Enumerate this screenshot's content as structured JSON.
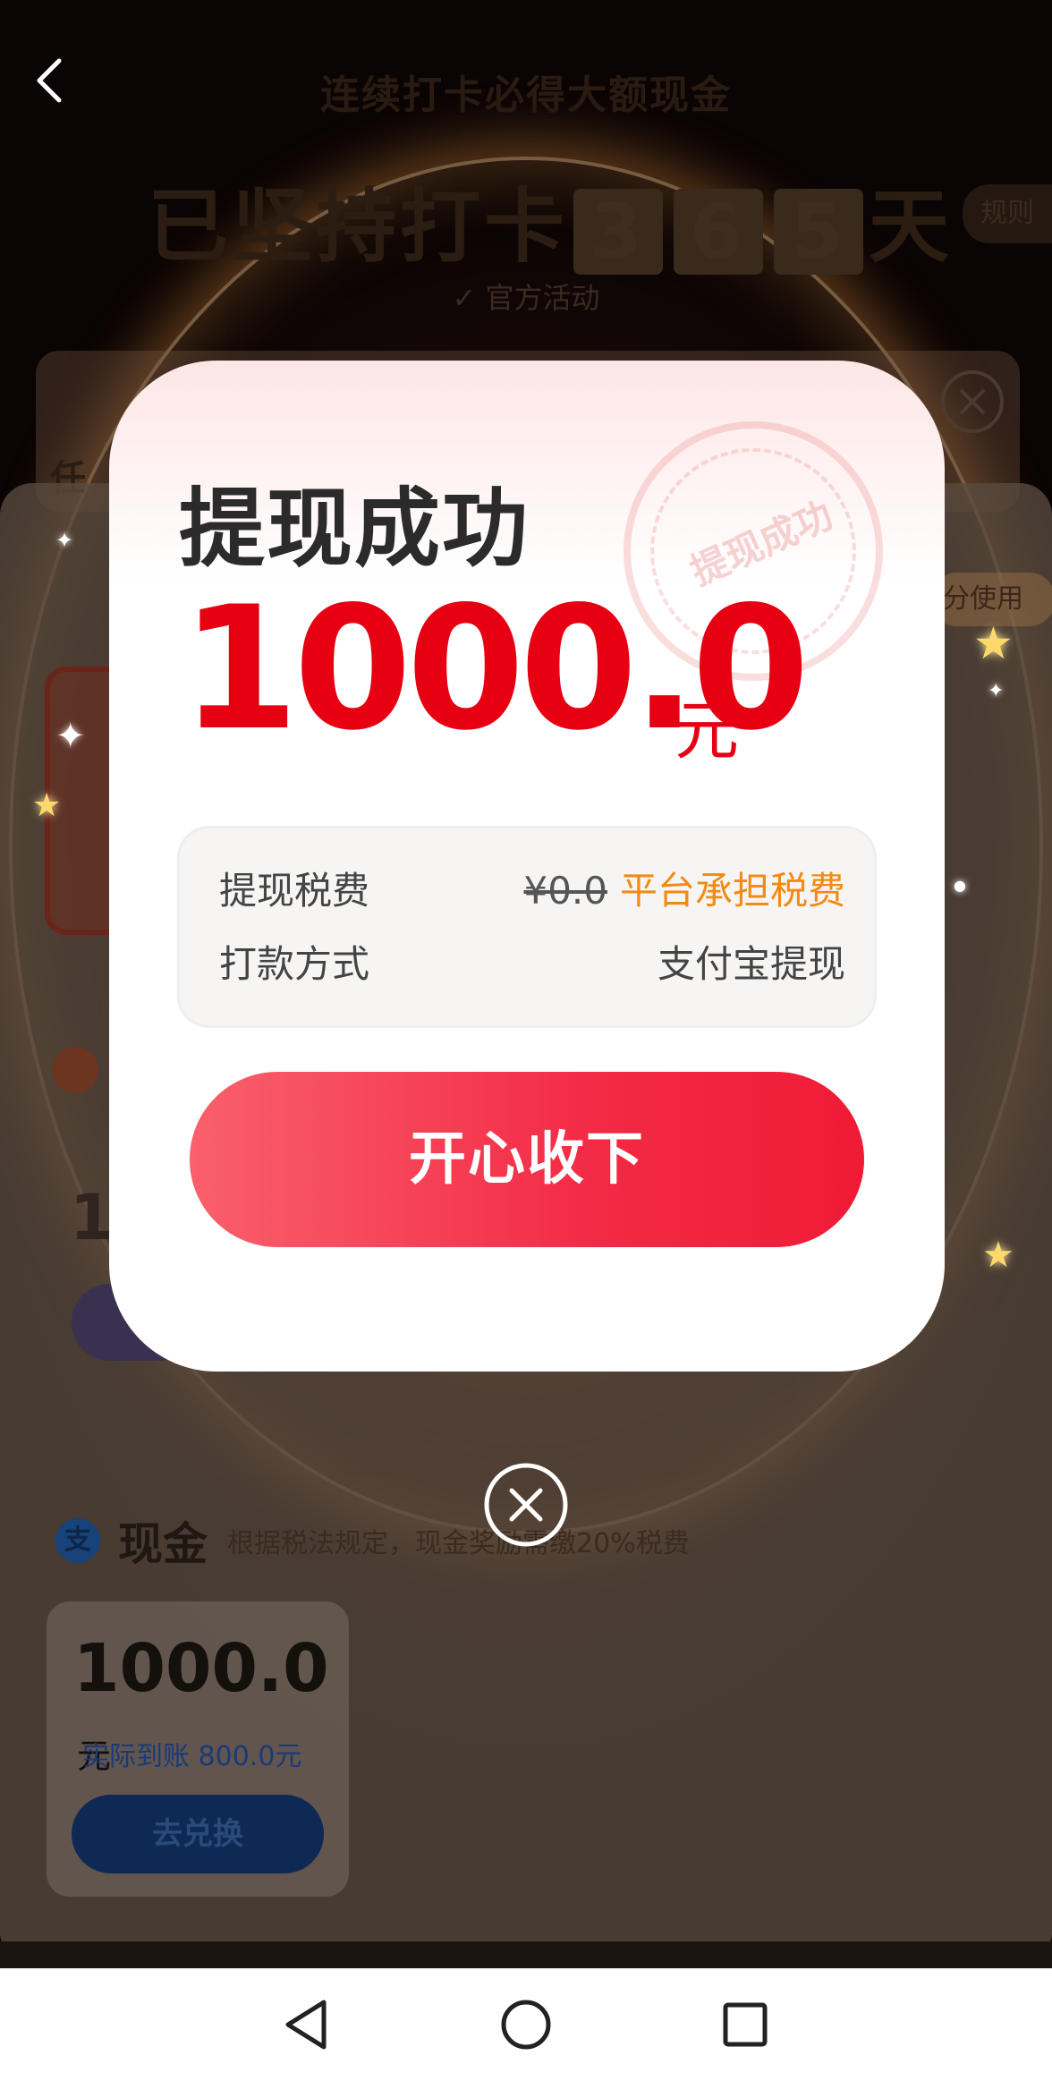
{
  "background": {
    "page_title": "连续打卡必得大额现金",
    "keep_text_prefix": "已坚持打卡",
    "day_digits": [
      "3",
      "6",
      "5"
    ],
    "keep_text_suffix": "天",
    "rule_label": "规则",
    "official_label": "✓ 官方活动",
    "task_label": "任",
    "points_pill": "分使用",
    "one_digit": "1",
    "cash_section": {
      "icon_char": "支",
      "title": "现金",
      "note": "根据税法规定，现金奖励需缴20%税费",
      "card_amount": "1000.0",
      "card_unit": "元",
      "actual_received": "实际到账 800.0元",
      "exchange_button": "去兑换"
    }
  },
  "dialog": {
    "title": "提现成功",
    "stamp_text": "提现成功",
    "amount": "1000.0",
    "amount_unit": "元",
    "rows": [
      {
        "label": "提现税费",
        "value_struck": "¥0.0",
        "value": "平台承担税费"
      },
      {
        "label": "打款方式",
        "value": "支付宝提现"
      }
    ],
    "confirm_button": "开心收下"
  },
  "icons": {
    "back": "chevron-left-icon",
    "close_bg": "close-circle-icon",
    "close_dialog": "close-circle-icon",
    "nav_back": "triangle-back-icon",
    "nav_home": "circle-home-icon",
    "nav_recent": "square-recent-icon"
  },
  "colors": {
    "amount_red": "#e60012",
    "tax_orange": "#f28a14",
    "button_red": "#f32a45"
  }
}
